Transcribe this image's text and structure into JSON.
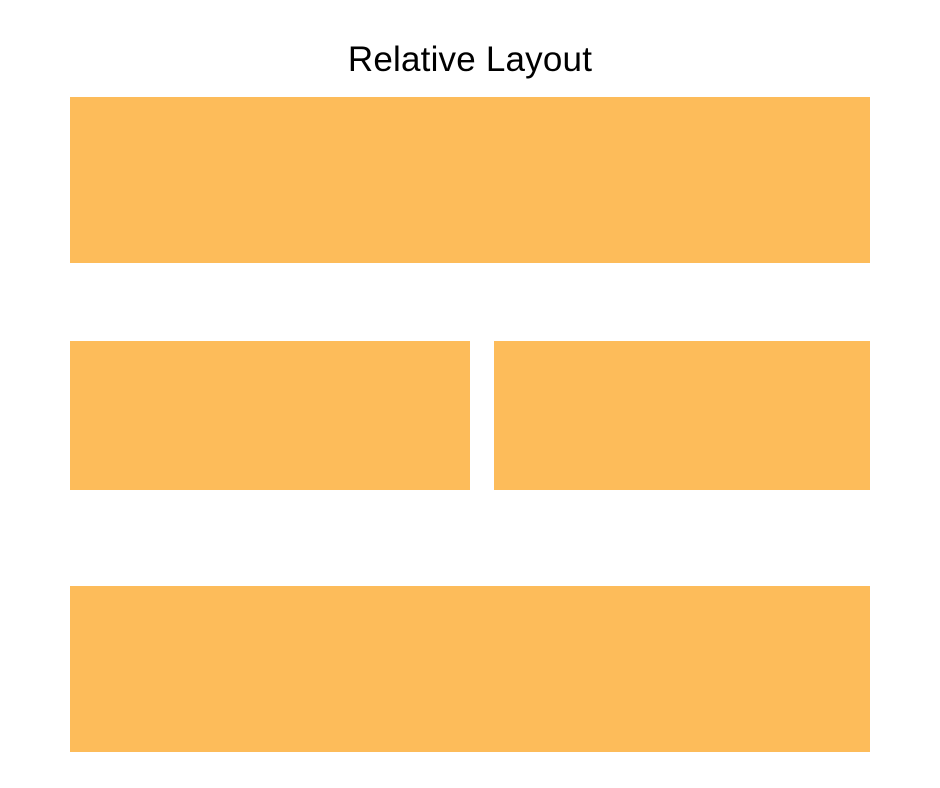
{
  "title": "Relative Layout",
  "colors": {
    "block_fill": "#FDBC5A",
    "background": "#FFFFFF",
    "title_text": "#000000"
  },
  "blocks": [
    {
      "id": "top"
    },
    {
      "id": "middle-left"
    },
    {
      "id": "middle-right"
    },
    {
      "id": "bottom"
    }
  ]
}
